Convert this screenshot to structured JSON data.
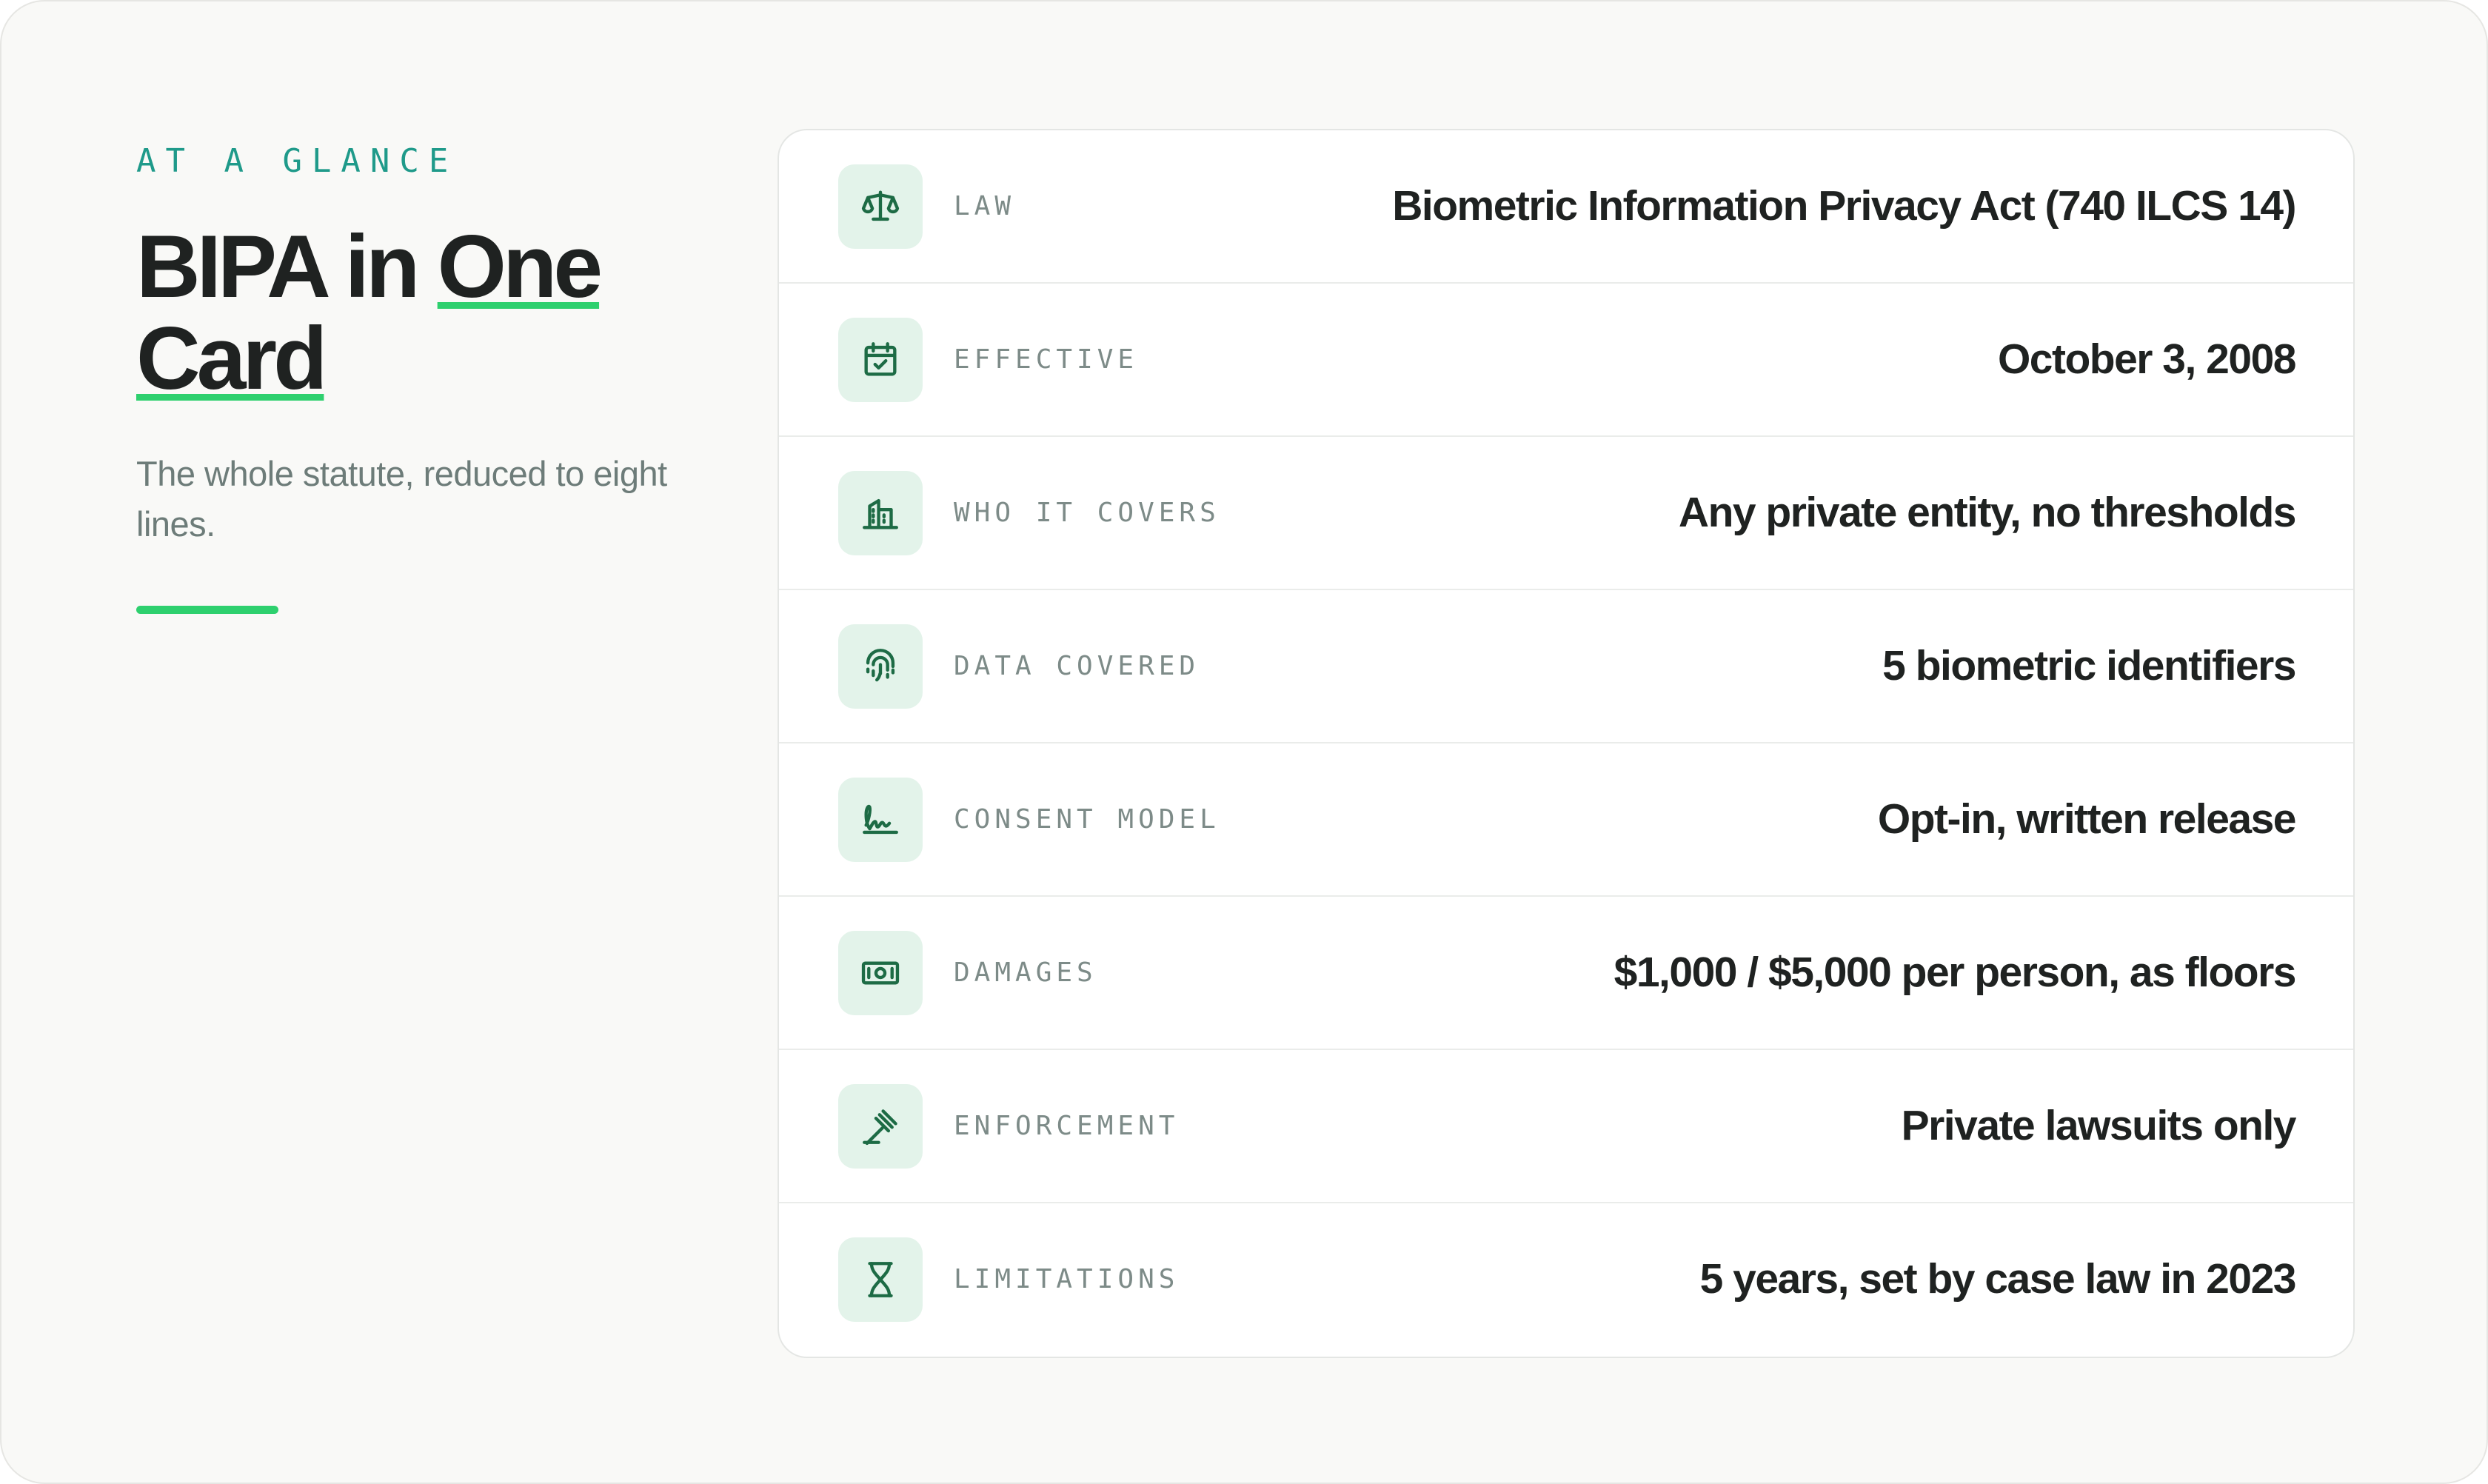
{
  "header": {
    "eyebrow": "AT A GLANCE",
    "title_part1": "BIPA in ",
    "title_highlight1": "One",
    "title_highlight2": "Card",
    "subtitle": "The whole statute, reduced to eight lines."
  },
  "colors": {
    "accent": "#2ed06e",
    "eyebrow": "#1f9a8a",
    "icon": "#1d6b45",
    "icon_tile": "#e3f3ea",
    "text": "#1f2221",
    "muted": "#7d8b88"
  },
  "rows": [
    {
      "icon": "scales-icon",
      "label": "LAW",
      "value": "Biometric Information Privacy Act (740 ILCS 14)"
    },
    {
      "icon": "calendar-check-icon",
      "label": "EFFECTIVE",
      "value": "October 3, 2008"
    },
    {
      "icon": "building-icon",
      "label": "WHO IT COVERS",
      "value": "Any private entity, no thresholds"
    },
    {
      "icon": "fingerprint-icon",
      "label": "DATA COVERED",
      "value": "5 biometric identifiers"
    },
    {
      "icon": "signature-icon",
      "label": "CONSENT MODEL",
      "value": "Opt-in, written release"
    },
    {
      "icon": "banknote-icon",
      "label": "DAMAGES",
      "value": "$1,000 / $5,000 per person, as floors"
    },
    {
      "icon": "gavel-icon",
      "label": "ENFORCEMENT",
      "value": "Private lawsuits only"
    },
    {
      "icon": "hourglass-icon",
      "label": "LIMITATIONS",
      "value": "5 years, set by case law in 2023"
    }
  ]
}
